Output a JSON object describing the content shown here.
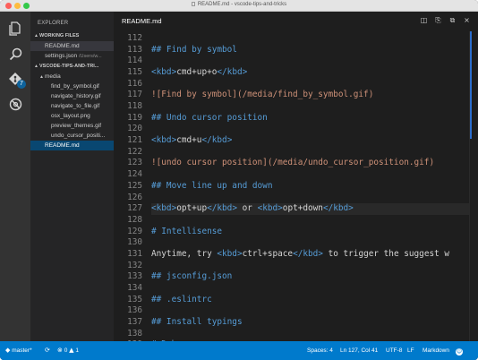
{
  "window": {
    "title": "README.md - vscode-tips-and-tricks"
  },
  "activity_bar": {
    "items": [
      {
        "name": "explorer",
        "icon": "files-icon"
      },
      {
        "name": "search",
        "icon": "search-icon"
      },
      {
        "name": "git",
        "icon": "git-icon",
        "badge": "7"
      },
      {
        "name": "debug",
        "icon": "debug-icon"
      }
    ]
  },
  "sidebar": {
    "header": "EXPLORER",
    "working_files_label": "WORKING FILES",
    "working_files": [
      {
        "name": "README.md",
        "path": ""
      },
      {
        "name": "settings.json",
        "path": "/Users/w..."
      }
    ],
    "project_label": "VSCODE-TIPS-AND-TRI...",
    "folder": "media",
    "folder_files": [
      "find_by_symbol.gif",
      "navigate_history.gif",
      "navigate_to_file.gif",
      "osx_layout.png",
      "preview_themes.gif",
      "undo_cursor_positi..."
    ],
    "root_file": "README.md"
  },
  "editor": {
    "tab_title": "README.md",
    "actions": [
      "split-editor-icon",
      "open-changes-icon",
      "open-preview-icon",
      "close-icon"
    ],
    "lines": [
      {
        "n": "112",
        "t": ""
      },
      {
        "n": "113",
        "t": "## Find by symbol"
      },
      {
        "n": "114",
        "t": ""
      },
      {
        "n": "115",
        "t": "<kbd>cmd+up+o</kbd>"
      },
      {
        "n": "116",
        "t": ""
      },
      {
        "n": "117",
        "t": "![Find by symbol](/media/find_by_symbol.gif)"
      },
      {
        "n": "118",
        "t": ""
      },
      {
        "n": "119",
        "t": "## Undo cursor position"
      },
      {
        "n": "120",
        "t": ""
      },
      {
        "n": "121",
        "t": "<kbd>cmd+u</kbd>"
      },
      {
        "n": "122",
        "t": ""
      },
      {
        "n": "123",
        "t": "![undo cursor position](/media/undo_cursor_position.gif)"
      },
      {
        "n": "124",
        "t": ""
      },
      {
        "n": "125",
        "t": "## Move line up and down"
      },
      {
        "n": "126",
        "t": ""
      },
      {
        "n": "127",
        "t": "<kbd>opt+up</kbd> or <kbd>opt+down</kbd>"
      },
      {
        "n": "128",
        "t": ""
      },
      {
        "n": "129",
        "t": "# Intellisense"
      },
      {
        "n": "130",
        "t": ""
      },
      {
        "n": "131",
        "t": "Anytime, try <kbd>ctrl+space</kbd> to trigger the suggest w"
      },
      {
        "n": "132",
        "t": ""
      },
      {
        "n": "133",
        "t": "## jsconfig.json"
      },
      {
        "n": "134",
        "t": ""
      },
      {
        "n": "135",
        "t": "## .eslintrc"
      },
      {
        "n": "136",
        "t": ""
      },
      {
        "n": "137",
        "t": "## Install typings"
      },
      {
        "n": "138",
        "t": ""
      },
      {
        "n": "139",
        "t": "# Debugger"
      }
    ]
  },
  "status_bar": {
    "branch": "master*",
    "sync_icon": "sync-icon",
    "errors": "0",
    "warnings": "1",
    "spaces": "Spaces: 4",
    "position": "Ln 127, Col 41",
    "encoding": "UTF-8",
    "eol": "LF",
    "language": "Markdown",
    "feedback_icon": "smiley-icon"
  },
  "colors": {
    "accent": "#007acc",
    "selection": "#094771",
    "heading": "#569cd6",
    "link": "#ce9178"
  }
}
